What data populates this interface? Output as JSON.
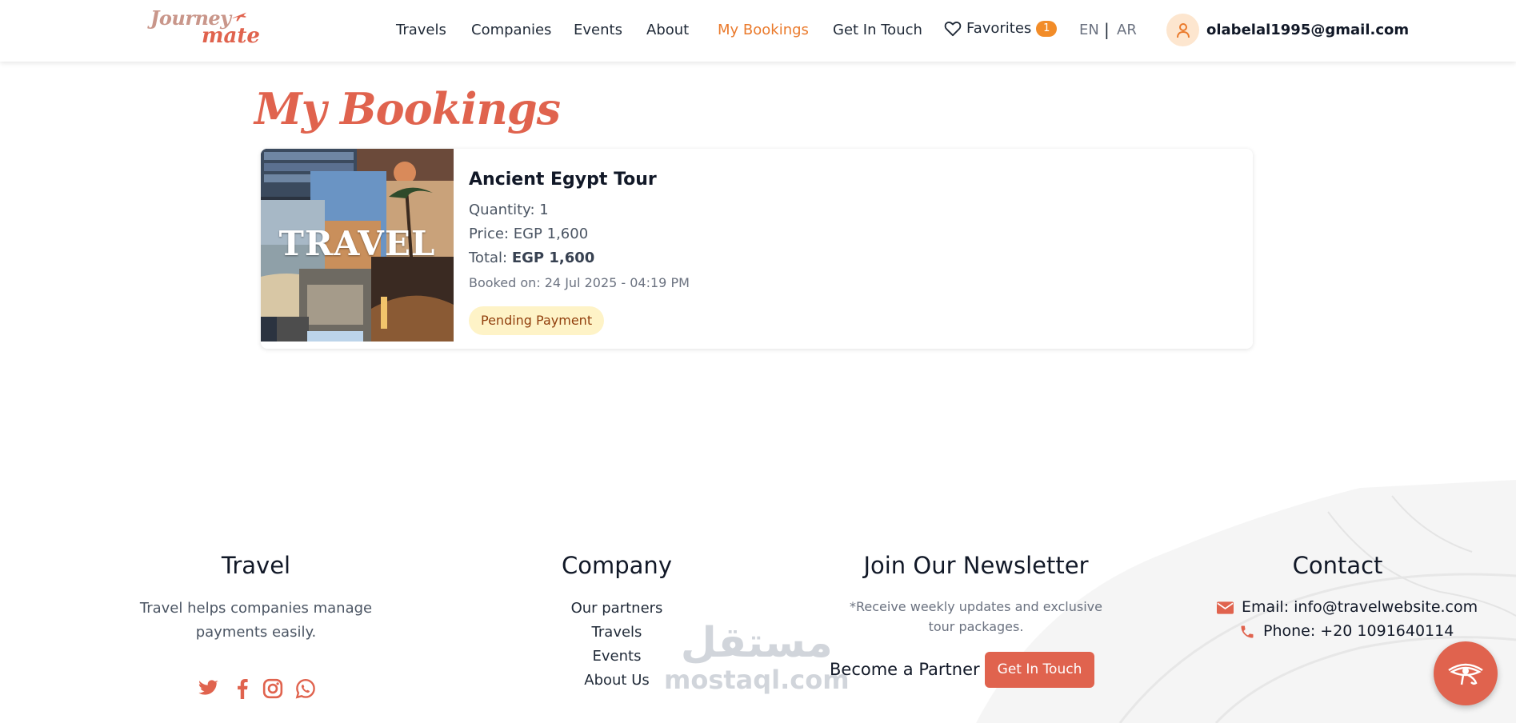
{
  "header": {
    "logo": {
      "line1": "Journey",
      "line2": "mate"
    },
    "nav": [
      {
        "label": "Travels",
        "active": false
      },
      {
        "label": "Companies",
        "active": false
      },
      {
        "label": "Events",
        "active": false
      },
      {
        "label": "About",
        "active": false
      },
      {
        "label": "My Bookings",
        "active": true
      },
      {
        "label": "Get In Touch",
        "active": false
      }
    ],
    "favorites": {
      "label": "Favorites",
      "count": "1"
    },
    "languages": [
      "EN",
      "AR"
    ],
    "user": {
      "email": "olabelal1995@gmail.com",
      "icon": "user-icon"
    }
  },
  "page": {
    "title": "My Bookings"
  },
  "bookings": [
    {
      "image_text": "TRAVEL",
      "title": "Ancient Egypt Tour",
      "quantity_label": "Quantity:",
      "quantity": "1",
      "price_label": "Price:",
      "price": "EGP 1,600",
      "total_label": "Total:",
      "total": "EGP 1,600",
      "booked_on_label": "Booked on:",
      "booked_on": "24 Jul 2025 - 04:19 PM",
      "status": "Pending Payment"
    }
  ],
  "footer": {
    "travel": {
      "title": "Travel",
      "text": "Travel helps companies manage payments easily.",
      "socials": [
        "twitter-icon",
        "facebook-icon",
        "instagram-icon",
        "whatsapp-icon"
      ]
    },
    "company": {
      "title": "Company",
      "links": [
        "Our partners",
        "Travels",
        "Events",
        "About Us"
      ]
    },
    "newsletter": {
      "title": "Join Our Newsletter",
      "text": "*Receive weekly updates and exclusive tour packages.",
      "partner_label": "Become a Partner",
      "button": "Get In Touch"
    },
    "contact": {
      "title": "Contact",
      "email": "Email: info@travelwebsite.com",
      "phone": "Phone: +20 1091640114"
    },
    "watermark": {
      "arabic": "مستقل",
      "latin": "mostaql.com"
    }
  },
  "colors": {
    "brand": "#e0634e",
    "active_nav": "#ea7a2c",
    "badge": "#f28c28",
    "status_bg": "#fef3c7",
    "status_text": "#92400e"
  }
}
